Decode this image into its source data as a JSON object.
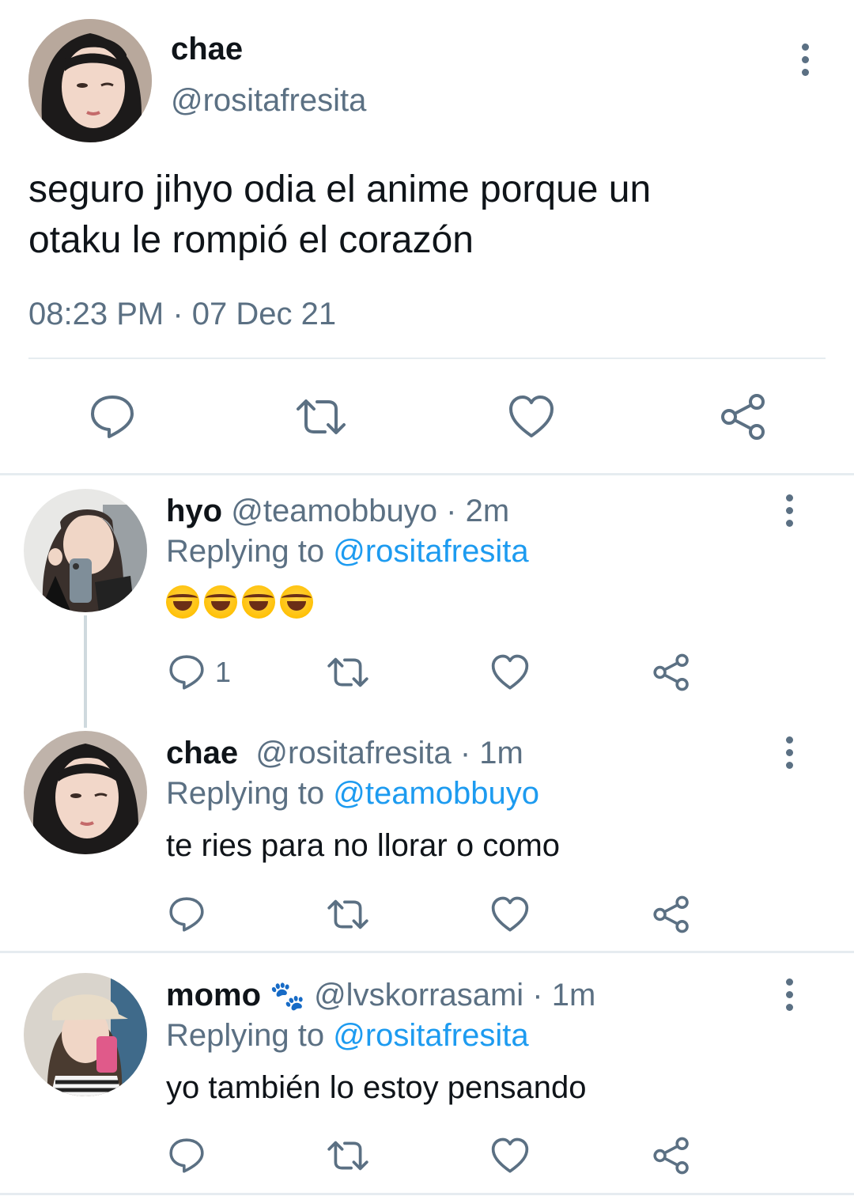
{
  "main_tweet": {
    "display_name": "chae",
    "handle": "@rositafresita",
    "text_line1": "seguro jihyo odia el anime porque un",
    "text_line2": "otaku le rompió el corazón",
    "timestamp": "08:23 PM · 07 Dec 21",
    "actions": {
      "reply_icon": "reply-bubble-icon",
      "retweet_icon": "retweet-icon",
      "like_icon": "heart-icon",
      "share_icon": "share-icon"
    }
  },
  "replies": [
    {
      "display_name": "hyo",
      "handle": "@teamobbuyo",
      "time": "· 2m",
      "replying_prefix": "Replying to",
      "replying_to": "@rositafresita",
      "emoji_text": "🤣🤣🤣🤣",
      "reply_count": "1"
    },
    {
      "display_name": "chae",
      "handle": "@rositafresita",
      "time": "· 1m",
      "replying_prefix": "Replying to",
      "replying_to": "@teamobbuyo",
      "text": "te ries para no llorar o como",
      "reply_count": ""
    },
    {
      "display_name": "momo",
      "name_badge": "🐾",
      "handle": "@lvskorrasami",
      "time": "· 1m",
      "replying_prefix": "Replying to",
      "replying_to": "@rositafresita",
      "text": "yo también lo estoy pensando",
      "reply_count": ""
    }
  ],
  "colors": {
    "text": "#0f1419",
    "muted": "#5b7083",
    "link": "#1d9bf0",
    "divider": "#e6ecf0"
  }
}
